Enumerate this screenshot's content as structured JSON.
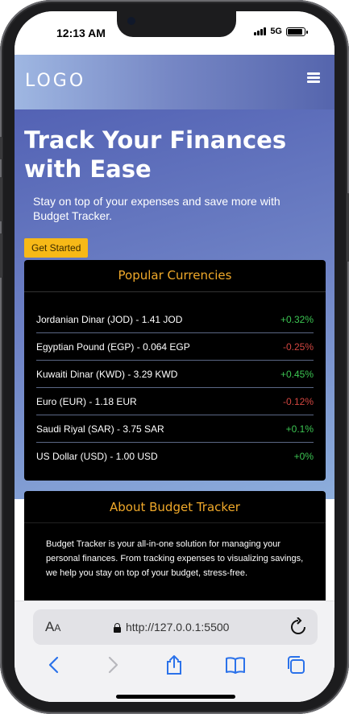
{
  "status_bar": {
    "time": "12:13 AM",
    "network": "5G",
    "battery_level": 0.9,
    "signal_icon": "cellular-signal-icon",
    "battery_icon": "battery-icon"
  },
  "site": {
    "logo": "LOGO",
    "menu_icon": "hamburger-menu-icon",
    "hero": {
      "title": "Track Your Finances with Ease",
      "subtitle": "Stay on top of your expenses and save more with Budget Tracker.",
      "cta_label": "Get Started"
    },
    "currencies": {
      "title": "Popular Currencies",
      "rows": [
        {
          "name": "Jordanian Dinar (JOD) - 1.41 JOD",
          "change": "+0.32%",
          "trend": "up"
        },
        {
          "name": "Egyptian Pound (EGP) - 0.064 EGP",
          "change": "-0.25%",
          "trend": "down"
        },
        {
          "name": "Kuwaiti Dinar (KWD) - 3.29 KWD",
          "change": "+0.45%",
          "trend": "up"
        },
        {
          "name": "Euro (EUR) - 1.18 EUR",
          "change": "-0.12%",
          "trend": "down"
        },
        {
          "name": "Saudi Riyal (SAR) - 3.75 SAR",
          "change": "+0.1%",
          "trend": "up"
        },
        {
          "name": "US Dollar (USD) - 1.00 USD",
          "change": "+0%",
          "trend": "up"
        }
      ]
    },
    "about": {
      "title": "About Budget Tracker",
      "text": "Budget Tracker is your all-in-one solution for managing your personal finances. From tracking expenses to visualizing savings, we help you stay on top of your budget, stress-free."
    },
    "colors": {
      "accent": "#f7b917",
      "card_title": "#f0a92a",
      "positive": "#3cc552",
      "negative": "#d24640"
    }
  },
  "browser": {
    "aa_label": "AA",
    "url": "http://127.0.0.1:5500",
    "toolbar": [
      "back-icon",
      "forward-icon",
      "share-icon",
      "bookmarks-icon",
      "tabs-icon"
    ]
  }
}
